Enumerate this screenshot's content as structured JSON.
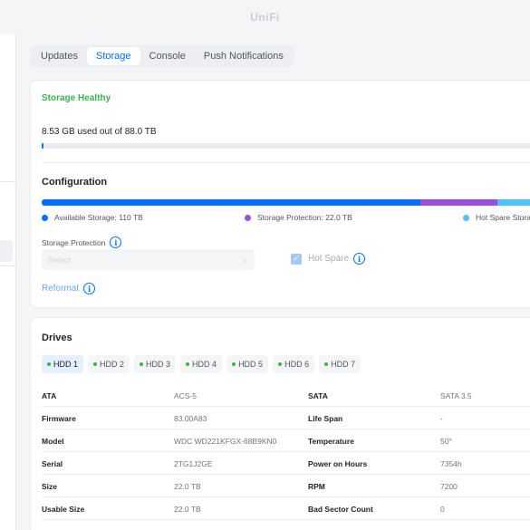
{
  "app": {
    "brand": "UniFi"
  },
  "tabs": [
    {
      "label": "Updates",
      "active": false
    },
    {
      "label": "Storage",
      "active": true
    },
    {
      "label": "Console",
      "active": false
    },
    {
      "label": "Push Notifications",
      "active": false
    }
  ],
  "storage": {
    "status": "Storage Healthy",
    "usage_text": "8.53 GB used out of 88.0 TB",
    "usage_fraction": 0.0001
  },
  "configuration": {
    "title": "Configuration",
    "segments": [
      {
        "label": "Available Storage: 110 TB",
        "color": "#006fff",
        "fraction": 0.76
      },
      {
        "label": "Storage Protection: 22.0 TB",
        "color": "#9b4fe0",
        "fraction": 0.155
      },
      {
        "label": "Hot Spare Stora",
        "color": "#4fc3f7",
        "fraction": 0.085
      }
    ],
    "storage_protection_label": "Storage Protection",
    "select_placeholder": "Select",
    "hot_spare_label": "Hot Spare",
    "hot_spare_checked": true,
    "reformat_label": "Reformat"
  },
  "drives": {
    "title": "Drives",
    "tabs": [
      "HDD 1",
      "HDD 2",
      "HDD 3",
      "HDD 4",
      "HDD 5",
      "HDD 6",
      "HDD 7"
    ],
    "active_tab": "HDD 1",
    "details": [
      {
        "k1": "ATA",
        "v1": "ACS-5",
        "k2": "SATA",
        "v2": "SATA 3.5"
      },
      {
        "k1": "Firmware",
        "v1": "83.00A83",
        "k2": "Life Span",
        "v2": "-"
      },
      {
        "k1": "Model",
        "v1": "WDC WD221KFGX-68B9KN0",
        "k2": "Temperature",
        "v2": "50°"
      },
      {
        "k1": "Serial",
        "v1": "2TG1J2GE",
        "k2": "Power on Hours",
        "v2": "7354h"
      },
      {
        "k1": "Size",
        "v1": "22.0 TB",
        "k2": "RPM",
        "v2": "7200"
      },
      {
        "k1": "Usable Size",
        "v1": "22.0 TB",
        "k2": "Bad Sector Count",
        "v2": "0"
      }
    ]
  },
  "icons": {
    "info": "info-icon",
    "check": "check-icon",
    "chevron": "chevron-down-icon",
    "status_dot": "status-dot-icon"
  }
}
